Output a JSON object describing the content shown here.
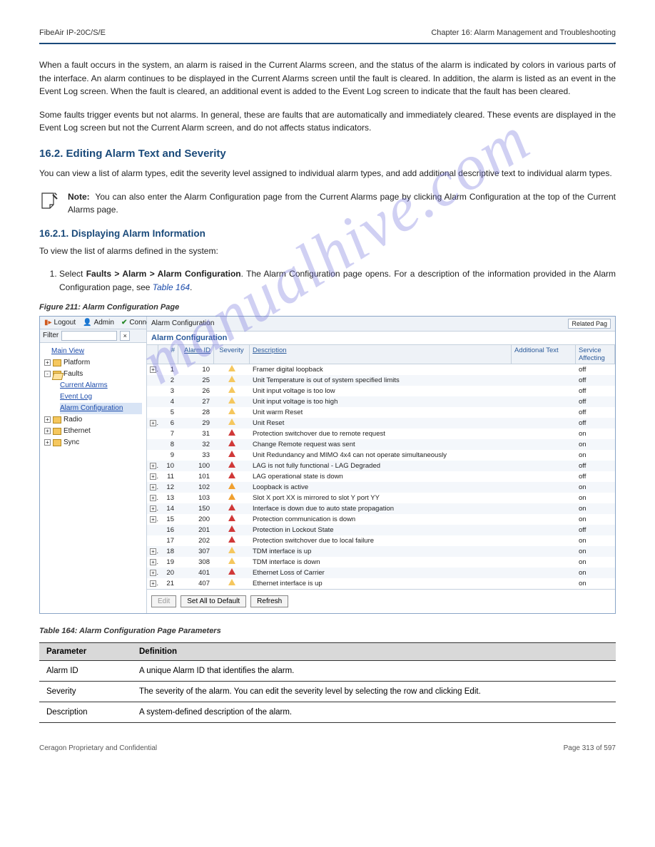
{
  "header": {
    "left": "FibeAir IP-20C/S/E",
    "right": "Chapter 16:  Alarm Management and Troubleshooting"
  },
  "intro_para": "When a fault occurs in the system, an alarm is raised in the Current Alarms screen, and the status of the alarm is indicated by colors in various parts of the interface. An alarm continues to be displayed in the Current Alarms screen until the fault is cleared. In addition, the alarm is listed as an event in the Event Log screen. When the fault is cleared, an additional event is added to the Event Log screen to indicate that the fault has been cleared.",
  "events_para": "Some faults trigger events but not alarms. In general, these are faults that are automatically and immediately cleared. These events are displayed in the Event Log screen but not the Current Alarm screen, and do not affects status indicators.",
  "h2_editing": "16.2.  Editing Alarm Text and Severity",
  "edit_intro": "You can view a list of alarm types, edit the severity level assigned to individual alarm types, and add additional descriptive text to individual alarm types.",
  "h3_alarms": "16.2.1. Displaying Alarm Information",
  "step_intro": "To view the list of alarms defined in the system:",
  "step1_pre": "Select ",
  "step1_bold": "Faults > Alarm > Alarm Configuration",
  "step1_post": ". The Alarm Configuration page opens. For a description of the information provided in the Alarm Configuration page, see ",
  "step1_link": "Table 164",
  "step1_end": ".",
  "note": {
    "label": "Note:",
    "text": "You can also enter the Alarm Configuration page from the Current Alarms page by clicking Alarm Configuration at the top of the Current Alarms page."
  },
  "figure_title": "Figure 211: Alarm Configuration Page",
  "ui": {
    "topbar": {
      "logout": "Logout",
      "admin": "Admin",
      "connection": "Connection"
    },
    "filter_label": "Filter",
    "related": "Related Pag",
    "content_title": "Alarm Configuration",
    "sub_title": "Alarm Configuration",
    "tree": {
      "main_view": "Main View",
      "platform": "Platform",
      "faults": "Faults",
      "current_alarms": "Current Alarms",
      "event_log": "Event Log",
      "alarm_configuration": "Alarm Configuration",
      "radio": "Radio",
      "ethernet": "Ethernet",
      "sync": "Sync"
    },
    "grid_headers": {
      "num": "#",
      "alarm_id": "Alarm ID",
      "severity": "Severity",
      "description": "Description",
      "additional": "Additional Text",
      "service": "Service Affecting"
    },
    "rows": [
      {
        "exp": "+",
        "n": "1",
        "id": "10",
        "sev": "minor",
        "desc": "Framer digital loopback",
        "svc": "off"
      },
      {
        "exp": "",
        "n": "2",
        "id": "25",
        "sev": "minor",
        "desc": "Unit Temperature is out of system specified limits",
        "svc": "off"
      },
      {
        "exp": "",
        "n": "3",
        "id": "26",
        "sev": "minor",
        "desc": "Unit input voltage is too low",
        "svc": "off"
      },
      {
        "exp": "",
        "n": "4",
        "id": "27",
        "sev": "minor",
        "desc": "Unit input voltage is too high",
        "svc": "off"
      },
      {
        "exp": "",
        "n": "5",
        "id": "28",
        "sev": "minor",
        "desc": "Unit warm Reset",
        "svc": "off"
      },
      {
        "exp": "+",
        "n": "6",
        "id": "29",
        "sev": "minor",
        "desc": "Unit Reset",
        "svc": "off"
      },
      {
        "exp": "",
        "n": "7",
        "id": "31",
        "sev": "major",
        "desc": "Protection switchover due to remote request",
        "svc": "on"
      },
      {
        "exp": "",
        "n": "8",
        "id": "32",
        "sev": "major",
        "desc": "Change Remote request was sent",
        "svc": "on"
      },
      {
        "exp": "",
        "n": "9",
        "id": "33",
        "sev": "major",
        "desc": "Unit Redundancy and MIMO 4x4 can not operate simultaneously",
        "svc": "on"
      },
      {
        "exp": "+",
        "n": "10",
        "id": "100",
        "sev": "major",
        "desc": "LAG is not fully functional - LAG Degraded",
        "svc": "off"
      },
      {
        "exp": "+",
        "n": "11",
        "id": "101",
        "sev": "major",
        "desc": "LAG operational state is down",
        "svc": "off"
      },
      {
        "exp": "+",
        "n": "12",
        "id": "102",
        "sev": "warn",
        "desc": "Loopback is active",
        "svc": "on"
      },
      {
        "exp": "+",
        "n": "13",
        "id": "103",
        "sev": "warn",
        "desc": "Slot X port XX is mirrored to slot Y port YY",
        "svc": "on"
      },
      {
        "exp": "+",
        "n": "14",
        "id": "150",
        "sev": "major",
        "desc": "Interface is down due to auto state propagation",
        "svc": "on"
      },
      {
        "exp": "+",
        "n": "15",
        "id": "200",
        "sev": "major",
        "desc": "Protection communication is down",
        "svc": "on"
      },
      {
        "exp": "",
        "n": "16",
        "id": "201",
        "sev": "major",
        "desc": "Protection in Lockout State",
        "svc": "off"
      },
      {
        "exp": "",
        "n": "17",
        "id": "202",
        "sev": "major",
        "desc": "Protection switchover due to local failure",
        "svc": "on"
      },
      {
        "exp": "+",
        "n": "18",
        "id": "307",
        "sev": "minor",
        "desc": "TDM interface is up",
        "svc": "on"
      },
      {
        "exp": "+",
        "n": "19",
        "id": "308",
        "sev": "minor",
        "desc": "TDM interface is down",
        "svc": "on"
      },
      {
        "exp": "+",
        "n": "20",
        "id": "401",
        "sev": "major",
        "desc": "Ethernet Loss of Carrier",
        "svc": "on"
      },
      {
        "exp": "+",
        "n": "21",
        "id": "407",
        "sev": "minor",
        "desc": "Ethernet interface is up",
        "svc": "on"
      }
    ],
    "buttons": {
      "edit": "Edit",
      "set_all": "Set All to Default",
      "refresh": "Refresh"
    }
  },
  "table164_title": "Table 164: Alarm Configuration Page Parameters",
  "table164": {
    "h1": "Parameter",
    "h2": "Definition",
    "rows": [
      {
        "p": "Alarm ID",
        "d": "A unique Alarm ID that identifies the alarm."
      },
      {
        "p": "Severity",
        "d": "The severity of the alarm. You can edit the severity level by selecting the row and clicking Edit."
      },
      {
        "p": "Description",
        "d": "A system-defined description of the alarm."
      }
    ]
  },
  "footer": {
    "left": "Ceragon Proprietary and Confidential",
    "right": "Page 313 of 597"
  }
}
